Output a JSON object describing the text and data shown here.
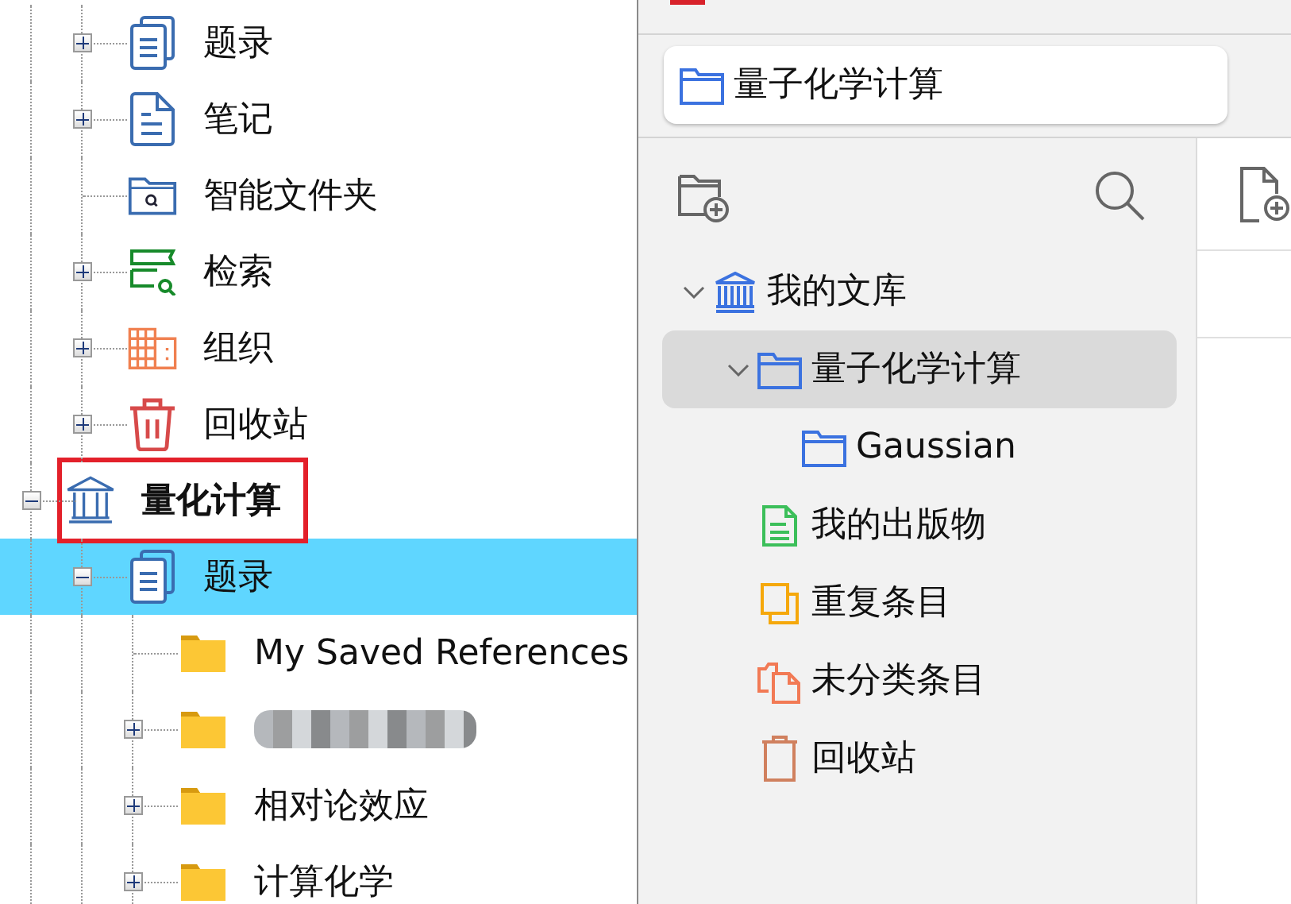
{
  "left_tree": [
    {
      "children": [
        {
          "label": "题录",
          "kind": "citations",
          "expanded": false
        },
        {
          "label": "笔记",
          "kind": "notes",
          "expanded": false
        },
        {
          "label": "智能文件夹",
          "kind": "smart_folder"
        },
        {
          "label": "检索",
          "kind": "search",
          "expanded": false
        },
        {
          "label": "组织",
          "kind": "organize",
          "expanded": false
        },
        {
          "label": "回收站",
          "kind": "trash",
          "expanded": false
        }
      ]
    },
    {
      "label": "量化计算",
      "kind": "library",
      "expanded": true,
      "highlighted": true,
      "children": [
        {
          "label": "题录",
          "kind": "citations",
          "expanded": true,
          "selected": true,
          "children": [
            {
              "label": "My Saved References",
              "kind": "folder"
            },
            {
              "kind": "redacted",
              "expanded": false
            },
            {
              "label": "相对论效应",
              "kind": "folder",
              "expanded": false
            },
            {
              "label": "计算化学",
              "kind": "folder",
              "expanded": false
            }
          ]
        }
      ]
    }
  ],
  "zotero": {
    "current_collection": "量子化学计算",
    "collections": [
      {
        "label": "我的文库",
        "kind": "library",
        "expanded": true,
        "selected": false,
        "children": [
          {
            "label": "量子化学计算",
            "kind": "folder",
            "expanded": true,
            "selected": true,
            "children": [
              {
                "label": "Gaussian",
                "kind": "folder",
                "selected": false
              }
            ]
          },
          {
            "label": "我的出版物",
            "kind": "publications",
            "selected": false
          },
          {
            "label": "重复条目",
            "kind": "duplicates",
            "selected": false
          },
          {
            "label": "未分类条目",
            "kind": "unfiled",
            "selected": false
          },
          {
            "label": "回收站",
            "kind": "trash",
            "selected": false
          }
        ]
      }
    ]
  }
}
